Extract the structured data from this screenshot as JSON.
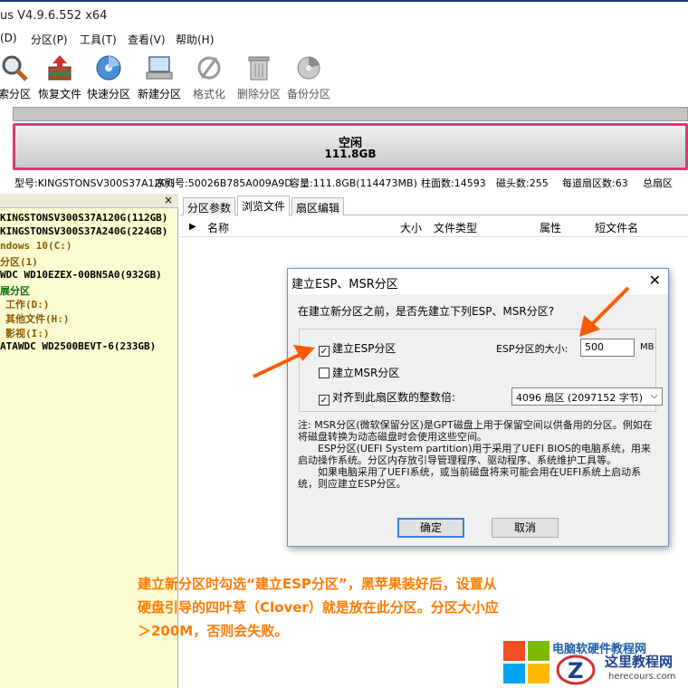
{
  "window": {
    "title": "us V4.9.6.552 x64"
  },
  "menu": [
    "(D)",
    "分区(P)",
    "工具(T)",
    "查看(V)",
    "帮助(H)"
  ],
  "toolbar": [
    {
      "label": "索分区",
      "icon": "search-partition-icon"
    },
    {
      "label": "恢复文件",
      "icon": "recover-files-icon"
    },
    {
      "label": "快速分区",
      "icon": "quick-partition-icon"
    },
    {
      "label": "新建分区",
      "icon": "new-partition-icon"
    },
    {
      "label": "格式化",
      "icon": "format-icon",
      "disabled": true
    },
    {
      "label": "删除分区",
      "icon": "delete-partition-icon",
      "disabled": true
    },
    {
      "label": "备份分区",
      "icon": "backup-partition-icon",
      "disabled": true
    }
  ],
  "disk_map": {
    "partition_name": "空闲",
    "partition_size": "111.8GB"
  },
  "disk_info": {
    "model": "型号:KINGSTONSV300S37A120G",
    "serial": "序列号:50026B785A009A9D",
    "capacity": "容量:111.8GB(114473MB)",
    "cylinders": "柱面数:14593",
    "heads": "磁头数:255",
    "sectors": "每道扇区数:63",
    "total": "总扇区"
  },
  "tree": [
    {
      "label": "KINGSTONSV300S37A120G(112GB)",
      "kind": "disk"
    },
    {
      "label": "KINGSTONSV300S37A240G(224GB)",
      "kind": "disk"
    },
    {
      "label": "ndows 10(C:)",
      "kind": "part"
    },
    {
      "label": "分区(1)",
      "kind": "part"
    },
    {
      "label": "WDC WD10EZEX-00BN5A0(932GB)",
      "kind": "disk"
    },
    {
      "label": "展分区",
      "kind": "green"
    },
    {
      "label": "工作(D:)",
      "kind": "part"
    },
    {
      "label": "其他文件(H:)",
      "kind": "part"
    },
    {
      "label": "影视(I:)",
      "kind": "part"
    },
    {
      "label": "ATAWDC WD2500BEVT-6(233GB)",
      "kind": "disk"
    }
  ],
  "tabs": [
    "分区参数",
    "浏览文件",
    "扇区编辑"
  ],
  "active_tab": "浏览文件",
  "columns": [
    "名称",
    "大小",
    "文件类型",
    "属性",
    "短文件名"
  ],
  "dialog": {
    "title": "建立ESP、MSR分区",
    "question": "在建立新分区之前，是否先建立下列ESP、MSR分区?",
    "esp_label": "建立ESP分区",
    "esp_checked": true,
    "esp_size_label": "ESP分区的大小:",
    "esp_size_value": "500",
    "esp_size_unit": "MB",
    "msr_label": "建立MSR分区",
    "msr_checked": false,
    "align_label": "对齐到此扇区数的整数倍:",
    "align_checked": true,
    "align_value": "4096 扇区 (2097152 字节)",
    "note1": "注: MSR分区(微软保留分区)是GPT磁盘上用于保留空间以供备用的分区。例如在将磁盘转换为动态磁盘时会使用这些空间。",
    "note2": "ESP分区(UEFI System partition)用于采用了UEFI BIOS的电脑系统，用来启动操作系统。分区内存放引导管理程序、驱动程序、系统维护工具等。",
    "note3": "如果电脑采用了UEFI系统，或当前磁盘将来可能会用在UEFI系统上启动系统，则应建立ESP分区。",
    "ok_label": "确定",
    "cancel_label": "取消"
  },
  "annotation": {
    "line1": "建立新分区时勾选“建立ESP分区”，黑苹果装好后，设置从",
    "line2": "硬盘引导的四叶草（Clover）就是放在此分区。分区大小应",
    "line3": "＞200M，否则会失败。"
  },
  "watermark": {
    "top_text": "电脑软硬件教程网",
    "site_name": "这里教程网",
    "url": "herecours.com"
  },
  "colors": {
    "annotation": "#ff7a00",
    "partition_border": "#d63a7a",
    "arrow": "#ff5a00"
  }
}
